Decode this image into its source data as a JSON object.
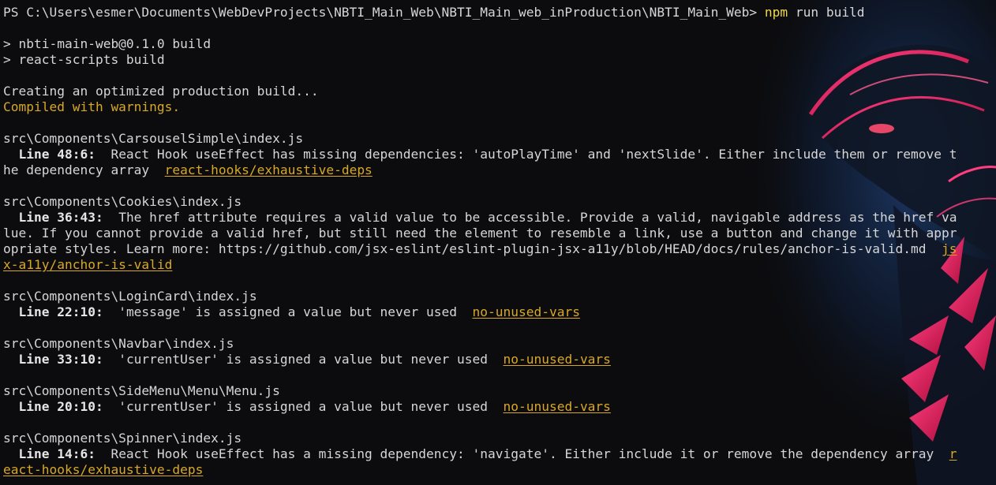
{
  "prompt": {
    "path": "PS C:\\Users\\esmer\\Documents\\WebDevProjects\\NBTI_Main_Web\\NBTI_Main_web_inProduction\\NBTI_Main_Web>",
    "cmd_npm": "npm",
    "cmd_args": " run build"
  },
  "script_lines": [
    "> nbti-main-web@0.1.0 build",
    "> react-scripts build"
  ],
  "status": {
    "creating": "Creating an optimized production build...",
    "compiled": "Compiled with warnings."
  },
  "warnings": [
    {
      "file": "src\\Components\\CarsouselSimple\\index.js",
      "loc": "  Line 48:6:",
      "msg_lines": [
        "  React Hook useEffect has missing dependencies: 'autoPlayTime' and 'nextSlide'. Either include them or remove t",
        "he dependency array  "
      ],
      "rule_parts": [
        "react-hooks/exhaustive-deps"
      ]
    },
    {
      "file": "src\\Components\\Cookies\\index.js",
      "loc": "  Line 36:43:",
      "msg_lines": [
        "  The href attribute requires a valid value to be accessible. Provide a valid, navigable address as the href va",
        "lue. If you cannot provide a valid href, but still need the element to resemble a link, use a button and change it with appr",
        "opriate styles. Learn more: https://github.com/jsx-eslint/eslint-plugin-jsx-a11y/blob/HEAD/docs/rules/anchor-is-valid.md  "
      ],
      "rule_parts": [
        "js",
        "x-a11y/anchor-is-valid"
      ]
    },
    {
      "file": "src\\Components\\LoginCard\\index.js",
      "loc": "  Line 22:10:",
      "msg_lines": [
        "  'message' is assigned a value but never used  "
      ],
      "rule_parts": [
        "no-unused-vars"
      ]
    },
    {
      "file": "src\\Components\\Navbar\\index.js",
      "loc": "  Line 33:10:",
      "msg_lines": [
        "  'currentUser' is assigned a value but never used  "
      ],
      "rule_parts": [
        "no-unused-vars"
      ]
    },
    {
      "file": "src\\Components\\SideMenu\\Menu\\Menu.js",
      "loc": "  Line 20:10:",
      "msg_lines": [
        "  'currentUser' is assigned a value but never used  "
      ],
      "rule_parts": [
        "no-unused-vars"
      ]
    },
    {
      "file": "src\\Components\\Spinner\\index.js",
      "loc": "  Line 14:6:",
      "msg_lines": [
        "  React Hook useEffect has a missing dependency: 'navigate'. Either include it or remove the dependency array  "
      ],
      "rule_parts": [
        "r",
        "eact-hooks/exhaustive-deps"
      ]
    }
  ],
  "colors": {
    "background": "#0c0c0e",
    "text": "#d6d6d6",
    "command": "#f2d64a",
    "warning": "#d8a825",
    "art_pink": "#e0245e",
    "art_blue": "#1e4a8c"
  }
}
